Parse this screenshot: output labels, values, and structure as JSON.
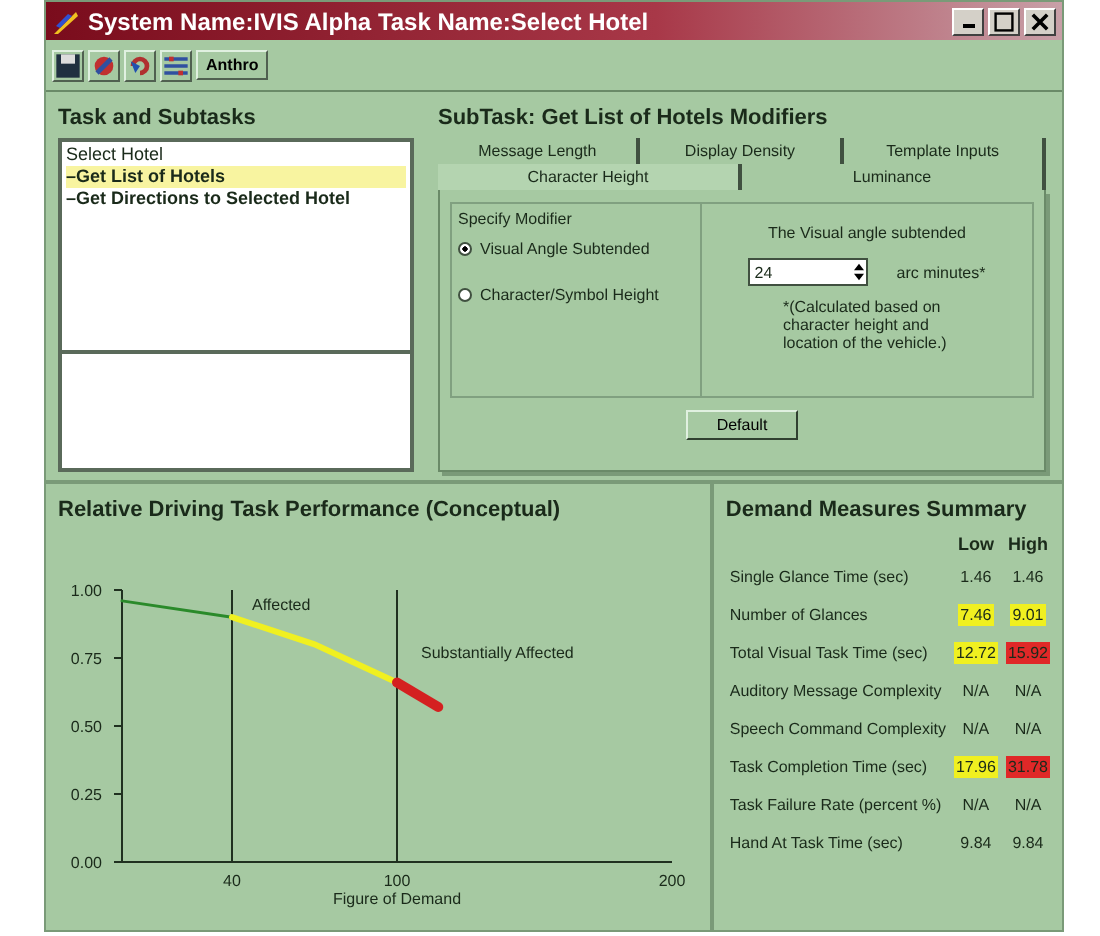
{
  "window": {
    "title": "System Name:IVIS Alpha Task Name:Select Hotel"
  },
  "toolbar": {
    "label_button": "Anthro"
  },
  "tasks": {
    "title": "Task and Subtasks",
    "items": [
      {
        "label": "Select Hotel",
        "selected": false,
        "children": [
          {
            "label": "–Get List of Hotels",
            "selected": true
          },
          {
            "label": "–Get Directions to Selected Hotel",
            "selected": false
          }
        ]
      }
    ]
  },
  "subtask": {
    "title": "SubTask: Get List of Hotels Modifiers",
    "tab_rows": [
      [
        {
          "label": "Message Length",
          "selected": false
        },
        {
          "label": "Display Density",
          "selected": false
        },
        {
          "label": "Template Inputs",
          "selected": false
        }
      ],
      [
        {
          "label": "Character Height",
          "selected": true
        },
        {
          "label": "Luminance",
          "selected": false
        }
      ]
    ],
    "group_title": "Specify Modifier",
    "radios": [
      {
        "label": "Visual Angle Subtended",
        "selected": true
      },
      {
        "label": "Character/Symbol Height",
        "selected": false
      }
    ],
    "angle_label": "The Visual angle subtended",
    "spinner_value": "24",
    "unit": "arc minutes*",
    "note": "*(Calculated based on character height and location of the vehicle.)",
    "default_button": "Default"
  },
  "performance": {
    "title": "Relative Driving Task Performance (Conceptual)",
    "chart_data": {
      "type": "line",
      "xlabel": "Figure of Demand",
      "xlim": [
        0,
        200
      ],
      "ylim": [
        0,
        1
      ],
      "xticks": [
        40,
        100,
        200
      ],
      "yticks": [
        {
          "value": 0,
          "label": "0.00"
        },
        {
          "value": 0.25,
          "label": "0.25"
        },
        {
          "value": 0.5,
          "label": "0.50"
        },
        {
          "value": 0.75,
          "label": "0.75"
        },
        {
          "value": 1,
          "label": "1.00"
        }
      ],
      "x": [
        0,
        40,
        70,
        100,
        115
      ],
      "series": [
        {
          "color": "#2a8a2a",
          "values": [
            0.96,
            0.9,
            null,
            null,
            null
          ]
        },
        {
          "name": "Affected",
          "color": "#f0f020",
          "values": [
            null,
            0.9,
            0.8,
            0.66,
            null
          ]
        },
        {
          "name": "Substantially Affected",
          "color": "#d42020",
          "values": [
            null,
            null,
            null,
            0.66,
            0.57
          ]
        }
      ]
    }
  },
  "summary": {
    "title": "Demand Measures Summary",
    "columns": [
      "Low",
      "High"
    ],
    "rows": [
      {
        "label": "Single Glance Time (sec)",
        "low": {
          "text": "1.46"
        },
        "high": {
          "text": "1.46"
        }
      },
      {
        "label": "Number of Glances",
        "low": {
          "text": "7.46",
          "color": "#f0f020"
        },
        "high": {
          "text": "9.01",
          "color": "#f0f020"
        }
      },
      {
        "label": "Total Visual Task Time (sec)",
        "low": {
          "text": "12.72",
          "color": "#f0f020"
        },
        "high": {
          "text": "15.92",
          "color": "#e02828"
        }
      },
      {
        "label": "Auditory Message Complexity",
        "low": {
          "text": "N/A"
        },
        "high": {
          "text": "N/A"
        }
      },
      {
        "label": "Speech Command Complexity",
        "low": {
          "text": "N/A"
        },
        "high": {
          "text": "N/A"
        }
      },
      {
        "label": "Task Completion Time (sec)",
        "low": {
          "text": "17.96",
          "color": "#f0f020"
        },
        "high": {
          "text": "31.78",
          "color": "#e02828"
        }
      },
      {
        "label": "Task Failure Rate (percent %)",
        "low": {
          "text": "N/A"
        },
        "high": {
          "text": "N/A"
        }
      },
      {
        "label": "Hand At Task Time (sec)",
        "low": {
          "text": "9.84"
        },
        "high": {
          "text": "9.84"
        }
      }
    ]
  }
}
